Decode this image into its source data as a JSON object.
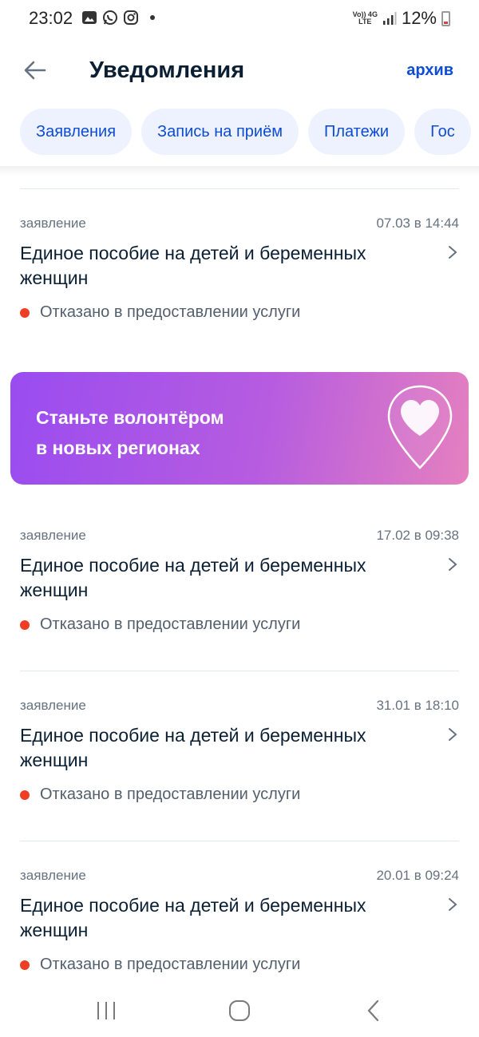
{
  "status_bar": {
    "time": "23:02",
    "battery": "12%",
    "net_top": "Vo)) 4G",
    "net_bottom": "LTE"
  },
  "header": {
    "title": "Уведомления",
    "archive_label": "архив"
  },
  "chips": [
    "Заявления",
    "Запись на приём",
    "Платежи",
    "Гос"
  ],
  "notifications": [
    {
      "type": "заявление",
      "date": "07.03 в 14:44",
      "title": "Единое пособие на детей и беременных женщин",
      "status": "Отказано в предоставлении услуги"
    },
    {
      "type": "заявление",
      "date": "17.02 в 09:38",
      "title": "Единое пособие на детей и беременных женщин",
      "status": "Отказано в предоставлении услуги"
    },
    {
      "type": "заявление",
      "date": "31.01 в 18:10",
      "title": "Единое пособие на детей и беременных женщин",
      "status": "Отказано в предоставлении услуги"
    },
    {
      "type": "заявление",
      "date": "20.01 в 09:24",
      "title": "Единое пособие на детей и беременных женщин",
      "status": "Отказано в предоставлении услуги"
    }
  ],
  "promo": {
    "line1": "Станьте волонтёром",
    "line2": "в новых регионах"
  },
  "colors": {
    "accent": "#0d4cd3",
    "chip_bg": "#edf2fe",
    "status_red": "#ee3f24"
  },
  "icons": {
    "back": "arrow-left-icon",
    "chevron": "chevron-right-icon",
    "promo": "heart-pin-icon",
    "nav_recent": "recent-apps-icon",
    "nav_home": "home-icon",
    "nav_back": "nav-back-icon"
  }
}
